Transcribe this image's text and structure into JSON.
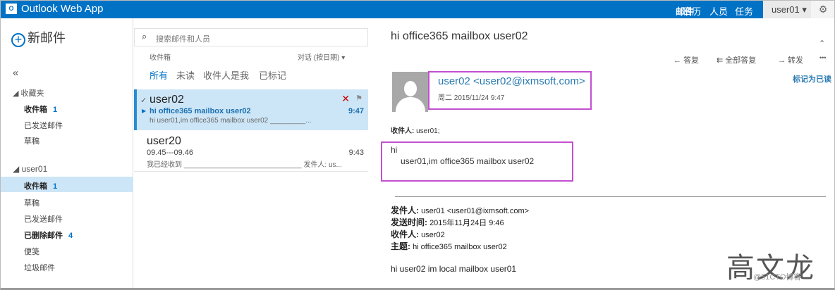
{
  "app": {
    "title": "Outlook Web App",
    "logo": "O"
  },
  "topnav": {
    "items": [
      "邮件",
      "日历",
      "人员",
      "任务"
    ],
    "user": "user01 ▾",
    "settings_icon": "⚙"
  },
  "leftnav": {
    "new_mail": "新邮件",
    "collapse": "«",
    "favorites": {
      "label": "收藏夹",
      "items": [
        {
          "label": "收件箱",
          "count": "1",
          "bold": true
        },
        {
          "label": "已发送邮件"
        },
        {
          "label": "草稿"
        }
      ]
    },
    "account": {
      "label": "user01",
      "items": [
        {
          "label": "收件箱",
          "count": "1",
          "bold": true
        },
        {
          "label": "草稿"
        },
        {
          "label": "已发送邮件"
        },
        {
          "label": "已删除邮件",
          "count": "4",
          "bold": true
        },
        {
          "label": "便笺"
        },
        {
          "label": "垃圾邮件"
        }
      ]
    }
  },
  "list": {
    "search_placeholder": "搜索邮件和人员",
    "folder": "收件箱",
    "sort": "对话 (按日期) ▾",
    "filters": [
      "所有",
      "未读",
      "收件人是我",
      "已标记"
    ],
    "messages": [
      {
        "sender": "user02",
        "subject": "hi office365 mailbox user02",
        "preview": "hi  user01,im office365 mailbox user02   _________...",
        "time": "9:47"
      },
      {
        "sender": "user20",
        "subject": "09.45---09.46",
        "preview": "我已经收到  ______________________________  发件人: us...",
        "time": "9:43"
      }
    ]
  },
  "reading": {
    "title": "hi office365 mailbox user02",
    "actions": [
      "← 答复",
      "⇇ 全部答复",
      "→ 转发",
      "•••"
    ],
    "from": "user02 <user02@ixmsoft.com>",
    "date": "周二 2015/11/24 9:47",
    "mark_read": "标记为已读",
    "to_label": "收件人:",
    "to": "user01;",
    "body_line1": "hi",
    "body_line2": "user01,im office365 mailbox user02",
    "fwd": [
      {
        "label": "发件人:",
        "value": "user01 <user01@ixmsoft.com>"
      },
      {
        "label": "发送时间:",
        "value": "2015年11月24日 9:46"
      },
      {
        "label": "收件人:",
        "value": "user02"
      },
      {
        "label": "主题:",
        "value": "hi office365 mailbox user02"
      }
    ],
    "fwd_body": "hi  user02     im local mailbox user01"
  },
  "watermark": {
    "name": "高文龙",
    "site": "@51CTO博客"
  },
  "colors": {
    "brand": "#0072c6",
    "highlight": "#cde6f7",
    "annotation": "#c34fd0"
  }
}
